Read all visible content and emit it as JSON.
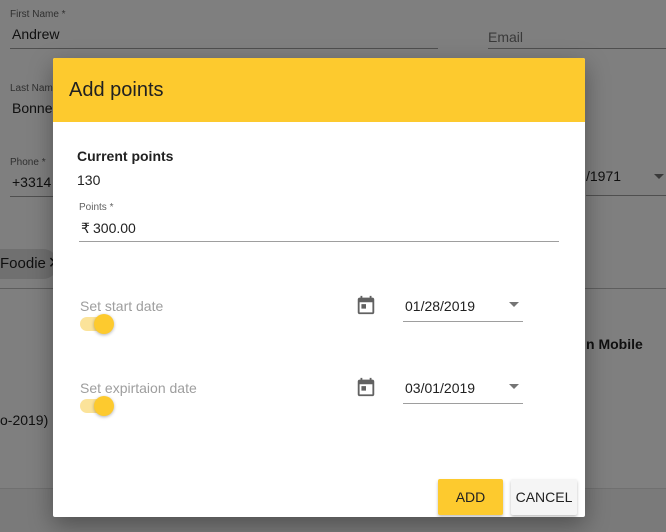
{
  "background": {
    "first_name": {
      "label": "First Name *",
      "value": "Andrew"
    },
    "email": {
      "placeholder": "Email"
    },
    "last_name": {
      "label": "Last Name *",
      "value": "Bonne"
    },
    "phone": {
      "label": "Phone *",
      "value": "+3314"
    },
    "birth_date": {
      "value": "/1971"
    },
    "chip": {
      "label": "Foodie",
      "remove_icon": "close-icon"
    },
    "mobile_text": "n Mobile",
    "year_text": "o-2019)"
  },
  "dialog": {
    "title": "Add points",
    "current_points": {
      "label": "Current points",
      "value": "130"
    },
    "points_field": {
      "label": "Points *",
      "currency": "₹",
      "value": "300.00"
    },
    "start_date": {
      "label": "Set start date",
      "enabled": true,
      "calendar_icon": "calendar-icon",
      "value": "01/28/2019"
    },
    "expiration_date": {
      "label": "Set expirtaion date",
      "enabled": true,
      "calendar_icon": "calendar-icon",
      "value": "03/01/2019"
    },
    "actions": {
      "add_label": "ADD",
      "cancel_label": "CANCEL"
    }
  },
  "colors": {
    "accent": "#fdca2e",
    "overlay": "rgba(0,0,0,0.5)"
  }
}
